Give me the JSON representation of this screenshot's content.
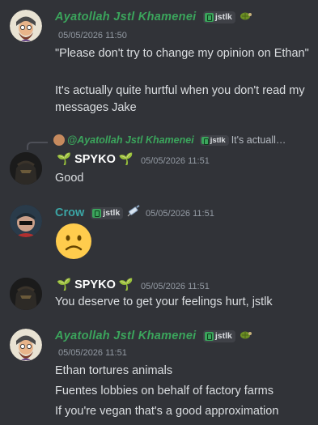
{
  "messages": [
    {
      "author": "Ayatollah Jstl Khamenei",
      "tag": "jstlk",
      "timestamp": "05/05/2026 11:50",
      "lines": [
        "\"Please don't try to change my opinion on Ethan\"",
        "It's actually quite hurtful when you don't read my messages Jake"
      ],
      "badge_icon": "turtle-icon"
    },
    {
      "reply": {
        "author": "@Ayatollah Jstl Khamenei",
        "tag": "jstlk",
        "preview": "It's actuall…"
      },
      "author": "SPYKO",
      "author_decor_left": "🌱",
      "author_decor_right": "🌱",
      "timestamp": "05/05/2026 11:51",
      "lines": [
        "Good"
      ]
    },
    {
      "author": "Crow",
      "tag": "jstlk",
      "badge_icon": "syringe-icon",
      "timestamp": "05/05/2026 11:51",
      "lines": [],
      "emoji": "slightly-frowning-face"
    },
    {
      "author": "SPYKO",
      "author_decor_left": "🌱",
      "author_decor_right": "🌱",
      "timestamp": "05/05/2026 11:51",
      "lines": [
        "You deserve to get your feelings hurt, jstlk"
      ]
    },
    {
      "author": "Ayatollah Jstl Khamenei",
      "tag": "jstlk",
      "badge_icon": "turtle-icon",
      "timestamp": "05/05/2026 11:51",
      "lines": [
        "Ethan tortures animals",
        "Fuentes lobbies on behalf of factory farms",
        "If you're vegan that's a good approximation"
      ]
    }
  ],
  "colors": {
    "background": "#313338",
    "khamenei_name": "#3ba55c",
    "crow_name": "#3ba5a5",
    "text": "#dbdee1",
    "timestamp": "#949ba4"
  }
}
